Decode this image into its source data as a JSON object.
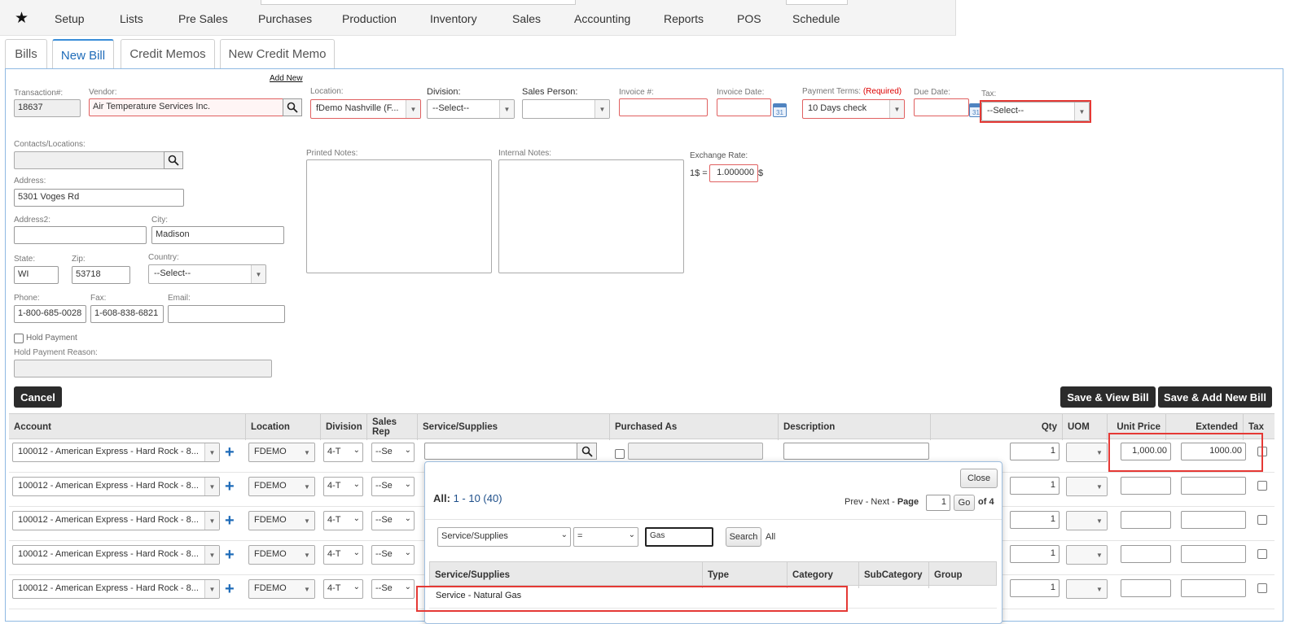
{
  "nav": {
    "items": [
      "Setup",
      "Lists",
      "Pre Sales",
      "Purchases",
      "Production",
      "Inventory",
      "Sales",
      "Accounting",
      "Reports",
      "POS",
      "Schedule"
    ]
  },
  "subtabs": [
    "Bills",
    "New Bill",
    "Credit Memos",
    "New Credit Memo"
  ],
  "form": {
    "add_new": "Add New",
    "transaction_label": "Transaction#:",
    "transaction_value": "18637",
    "vendor_label": "Vendor:",
    "vendor_value": "Air Temperature Services Inc.",
    "location_label": "Location:",
    "location_value": "fDemo Nashville (F...",
    "division_label": "Division:",
    "division_value": "--Select--",
    "salesperson_label": "Sales Person:",
    "invoice_no_label": "Invoice #:",
    "invoice_date_label": "Invoice Date:",
    "payment_terms_label": "Payment Terms:",
    "payment_terms_required": "(Required)",
    "payment_terms_value": "10 Days check",
    "due_date_label": "Due Date:",
    "tax_label": "Tax:",
    "tax_value": "--Select--",
    "calendar_day": "31",
    "contacts_label": "Contacts/Locations:",
    "printed_notes_label": "Printed Notes:",
    "internal_notes_label": "Internal Notes:",
    "exchange_label": "Exchange Rate:",
    "exchange_prefix": "1$ =",
    "exchange_value": "1.000000",
    "exchange_suffix": "$",
    "address_label": "Address:",
    "address_value": "5301 Voges Rd",
    "address2_label": "Address2:",
    "city_label": "City:",
    "city_value": "Madison",
    "state_label": "State:",
    "state_value": "WI",
    "zip_label": "Zip:",
    "zip_value": "53718",
    "country_label": "Country:",
    "country_value": "--Select--",
    "phone_label": "Phone:",
    "phone_value": "1-800-685-0028",
    "fax_label": "Fax:",
    "fax_value": "1-608-838-6821",
    "email_label": "Email:",
    "hold_payment_label": "Hold Payment",
    "hold_reason_label": "Hold Payment Reason:"
  },
  "buttons": {
    "cancel": "Cancel",
    "save_view": "Save & View Bill",
    "save_add": "Save & Add New Bill"
  },
  "grid": {
    "headers": [
      "Account",
      "Location",
      "Division",
      "Sales Rep",
      "Service/Supplies",
      "Purchased As",
      "Description",
      "Qty",
      "UOM",
      "Unit Price",
      "Extended",
      "Tax"
    ],
    "rows": [
      {
        "account": "100012 - American Express - Hard Rock - 8...",
        "location": "FDEMO",
        "division": "4-T",
        "salesrep": "--Se",
        "qty": "1",
        "unit_price": "1,000.00",
        "extended": "1000.00"
      },
      {
        "account": "100012 - American Express - Hard Rock - 8...",
        "location": "FDEMO",
        "division": "4-T",
        "salesrep": "--Se",
        "qty": "1",
        "unit_price": "",
        "extended": ""
      },
      {
        "account": "100012 - American Express - Hard Rock - 8...",
        "location": "FDEMO",
        "division": "4-T",
        "salesrep": "--Se",
        "qty": "1",
        "unit_price": "",
        "extended": ""
      },
      {
        "account": "100012 - American Express - Hard Rock - 8...",
        "location": "FDEMO",
        "division": "4-T",
        "salesrep": "--Se",
        "qty": "1",
        "unit_price": "",
        "extended": ""
      },
      {
        "account": "100012 - American Express - Hard Rock - 8...",
        "location": "FDEMO",
        "division": "4-T",
        "salesrep": "--Se",
        "qty": "1",
        "unit_price": "",
        "extended": ""
      }
    ]
  },
  "popup": {
    "close": "Close",
    "all_label": "All:",
    "range": "1 - 10 (40)",
    "prev": "Prev",
    "sep": "-",
    "next": "Next",
    "page_label": "Page",
    "page_value": "1",
    "go": "Go",
    "of_pages": "of 4",
    "filter_field": "Service/Supplies",
    "filter_op": "=",
    "filter_value": "Gas",
    "search": "Search",
    "all_link": "All",
    "headers": [
      "Service/Supplies",
      "Type",
      "Category",
      "SubCategory",
      "Group"
    ],
    "result_row": "Service - Natural Gas"
  },
  "colors": {
    "accent": "#1e6bb8",
    "highlight": "#e53935",
    "dark_button": "#2b2b2b"
  }
}
